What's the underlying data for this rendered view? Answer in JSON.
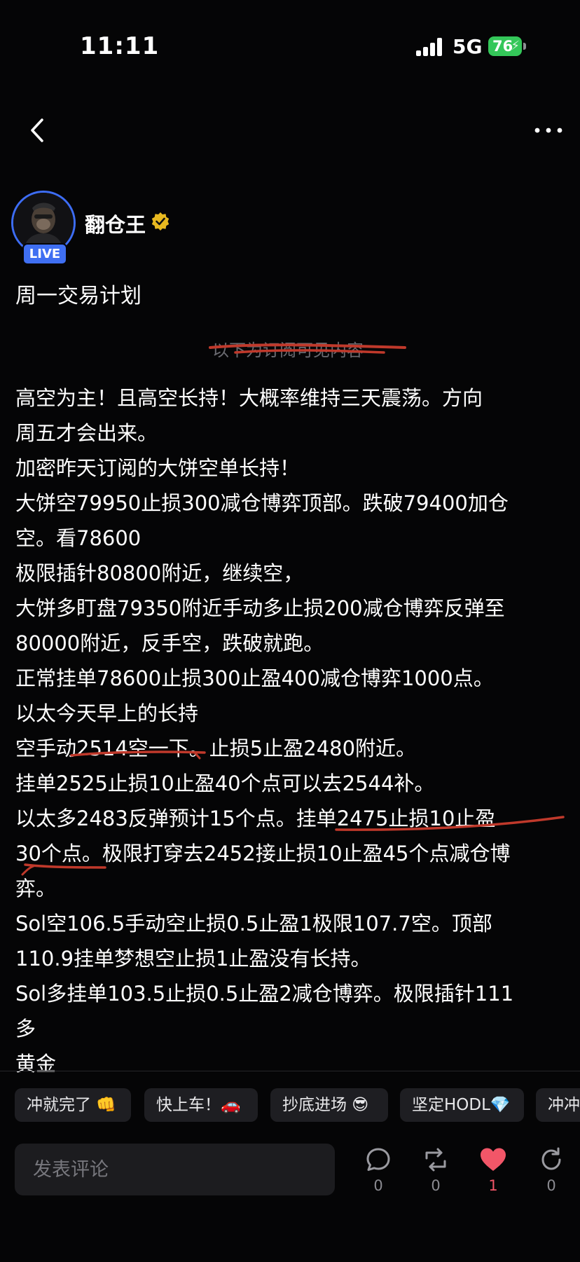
{
  "status_bar": {
    "time": "11:11",
    "network": "5G",
    "battery": "76"
  },
  "nav": {
    "back_icon": "chevron-left-icon",
    "more_icon": "ellipsis-icon"
  },
  "author": {
    "name": "翻仓王",
    "live_badge": "LIVE",
    "verified_color": "#e8b920"
  },
  "post": {
    "title": "周一交易计划",
    "subscriber_divider": "以下为订阅可见内容",
    "lines": [
      "高空为主！且高空长持！大概率维持三天震荡。方向",
      "周五才会出来。",
      "加密昨天订阅的大饼空单长持！",
      "大饼空79950止损300减仓博弈顶部。跌破79400加仓",
      "空。看78600",
      "极限插针80800附近，继续空，",
      "大饼多盯盘79350附近手动多止损200减仓博弈反弹至",
      "80000附近，反手空，跌破就跑。",
      "正常挂单78600止损300止盈400减仓博弈1000点。",
      "以太今天早上的长持",
      "空手动2514空一下。止损5止盈2480附近。",
      "挂单2525止损10止盈40个点可以去2544补。",
      "以太多2483反弹预计15个点。挂单2475止损10止盈",
      "30个点。极限打穿去2452接止损10止盈45个点减仓博",
      "弈。",
      "Sol空106.5手动空止损0.5止盈1极限107.7空。顶部",
      "110.9挂单梦想空止损1止盈没有长持。",
      "Sol多挂单103.5止损0.5止盈2减仓博弈。极限插针111",
      "多",
      "黄金"
    ]
  },
  "quick_replies": [
    "冲就完了 👊",
    "快上车！🚗",
    "抄底进场 😎",
    "坚定HODL💎",
    "冲冲"
  ],
  "comment": {
    "placeholder": "发表评论"
  },
  "actions": {
    "comments": "0",
    "reposts": "0",
    "likes": "1",
    "shares": "0"
  },
  "colors": {
    "accent_blue": "#3f6ff2",
    "like_red": "#f25668",
    "annotation_red": "#c0392b"
  }
}
